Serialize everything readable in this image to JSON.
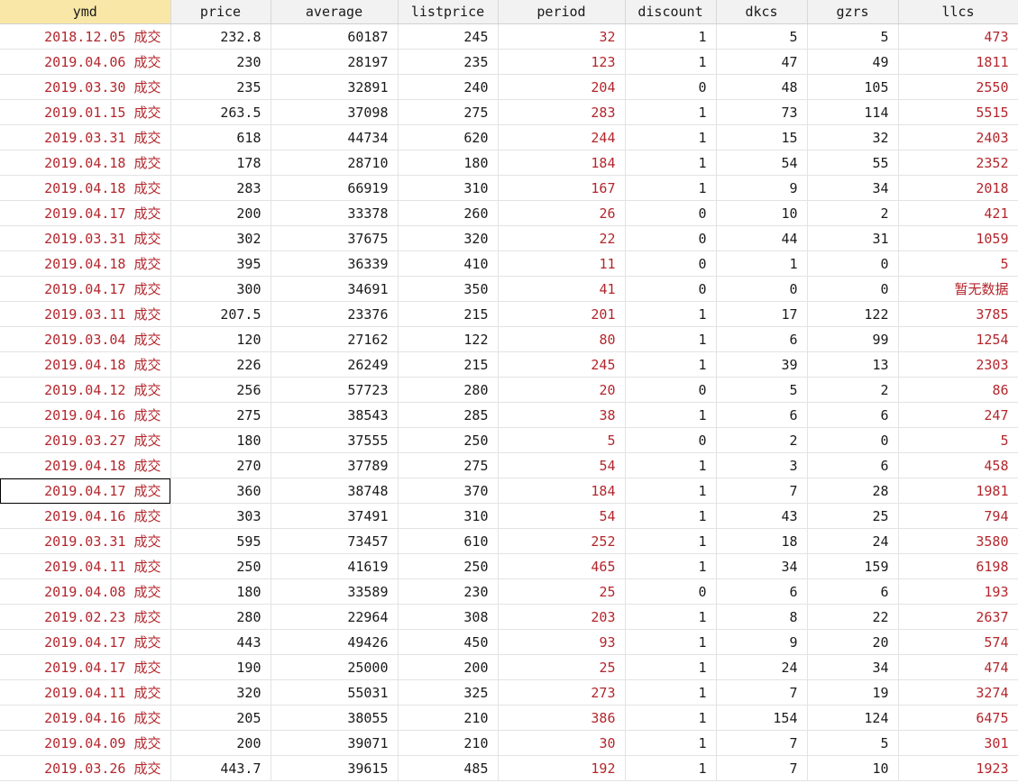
{
  "colors": {
    "header_bg": "#f2f2f2",
    "selected_header_bg": "#f9e7a7",
    "string_text": "#b3262c",
    "numeric_text": "#1a1a1a",
    "grid_line": "#e3e3e3"
  },
  "table": {
    "selected_column": "ymd",
    "active_cell": {
      "row": 18,
      "column": "ymd"
    },
    "columns": [
      {
        "key": "ymd",
        "label": "ymd",
        "text": true
      },
      {
        "key": "price",
        "label": "price",
        "text": false
      },
      {
        "key": "average",
        "label": "average",
        "text": false
      },
      {
        "key": "listprice",
        "label": "listprice",
        "text": false
      },
      {
        "key": "period",
        "label": "period",
        "text": true
      },
      {
        "key": "discount",
        "label": "discount",
        "text": false
      },
      {
        "key": "dkcs",
        "label": "dkcs",
        "text": false
      },
      {
        "key": "gzrs",
        "label": "gzrs",
        "text": false
      },
      {
        "key": "llcs",
        "label": "llcs",
        "text": true
      }
    ],
    "rows": [
      [
        "2018.12.05 成交",
        "232.8",
        "60187",
        "245",
        "32",
        "1",
        "5",
        "5",
        "473"
      ],
      [
        "2019.04.06 成交",
        "230",
        "28197",
        "235",
        "123",
        "1",
        "47",
        "49",
        "1811"
      ],
      [
        "2019.03.30 成交",
        "235",
        "32891",
        "240",
        "204",
        "0",
        "48",
        "105",
        "2550"
      ],
      [
        "2019.01.15 成交",
        "263.5",
        "37098",
        "275",
        "283",
        "1",
        "73",
        "114",
        "5515"
      ],
      [
        "2019.03.31 成交",
        "618",
        "44734",
        "620",
        "244",
        "1",
        "15",
        "32",
        "2403"
      ],
      [
        "2019.04.18 成交",
        "178",
        "28710",
        "180",
        "184",
        "1",
        "54",
        "55",
        "2352"
      ],
      [
        "2019.04.18 成交",
        "283",
        "66919",
        "310",
        "167",
        "1",
        "9",
        "34",
        "2018"
      ],
      [
        "2019.04.17 成交",
        "200",
        "33378",
        "260",
        "26",
        "0",
        "10",
        "2",
        "421"
      ],
      [
        "2019.03.31 成交",
        "302",
        "37675",
        "320",
        "22",
        "0",
        "44",
        "31",
        "1059"
      ],
      [
        "2019.04.18 成交",
        "395",
        "36339",
        "410",
        "11",
        "0",
        "1",
        "0",
        "5"
      ],
      [
        "2019.04.17 成交",
        "300",
        "34691",
        "350",
        "41",
        "0",
        "0",
        "0",
        "暂无数据"
      ],
      [
        "2019.03.11 成交",
        "207.5",
        "23376",
        "215",
        "201",
        "1",
        "17",
        "122",
        "3785"
      ],
      [
        "2019.03.04 成交",
        "120",
        "27162",
        "122",
        "80",
        "1",
        "6",
        "99",
        "1254"
      ],
      [
        "2019.04.18 成交",
        "226",
        "26249",
        "215",
        "245",
        "1",
        "39",
        "13",
        "2303"
      ],
      [
        "2019.04.12 成交",
        "256",
        "57723",
        "280",
        "20",
        "0",
        "5",
        "2",
        "86"
      ],
      [
        "2019.04.16 成交",
        "275",
        "38543",
        "285",
        "38",
        "1",
        "6",
        "6",
        "247"
      ],
      [
        "2019.03.27 成交",
        "180",
        "37555",
        "250",
        "5",
        "0",
        "2",
        "0",
        "5"
      ],
      [
        "2019.04.18 成交",
        "270",
        "37789",
        "275",
        "54",
        "1",
        "3",
        "6",
        "458"
      ],
      [
        "2019.04.17 成交",
        "360",
        "38748",
        "370",
        "184",
        "1",
        "7",
        "28",
        "1981"
      ],
      [
        "2019.04.16 成交",
        "303",
        "37491",
        "310",
        "54",
        "1",
        "43",
        "25",
        "794"
      ],
      [
        "2019.03.31 成交",
        "595",
        "73457",
        "610",
        "252",
        "1",
        "18",
        "24",
        "3580"
      ],
      [
        "2019.04.11 成交",
        "250",
        "41619",
        "250",
        "465",
        "1",
        "34",
        "159",
        "6198"
      ],
      [
        "2019.04.08 成交",
        "180",
        "33589",
        "230",
        "25",
        "0",
        "6",
        "6",
        "193"
      ],
      [
        "2019.02.23 成交",
        "280",
        "22964",
        "308",
        "203",
        "1",
        "8",
        "22",
        "2637"
      ],
      [
        "2019.04.17 成交",
        "443",
        "49426",
        "450",
        "93",
        "1",
        "9",
        "20",
        "574"
      ],
      [
        "2019.04.17 成交",
        "190",
        "25000",
        "200",
        "25",
        "1",
        "24",
        "34",
        "474"
      ],
      [
        "2019.04.11 成交",
        "320",
        "55031",
        "325",
        "273",
        "1",
        "7",
        "19",
        "3274"
      ],
      [
        "2019.04.16 成交",
        "205",
        "38055",
        "210",
        "386",
        "1",
        "154",
        "124",
        "6475"
      ],
      [
        "2019.04.09 成交",
        "200",
        "39071",
        "210",
        "30",
        "1",
        "7",
        "5",
        "301"
      ],
      [
        "2019.03.26 成交",
        "443.7",
        "39615",
        "485",
        "192",
        "1",
        "7",
        "10",
        "1923"
      ]
    ]
  }
}
